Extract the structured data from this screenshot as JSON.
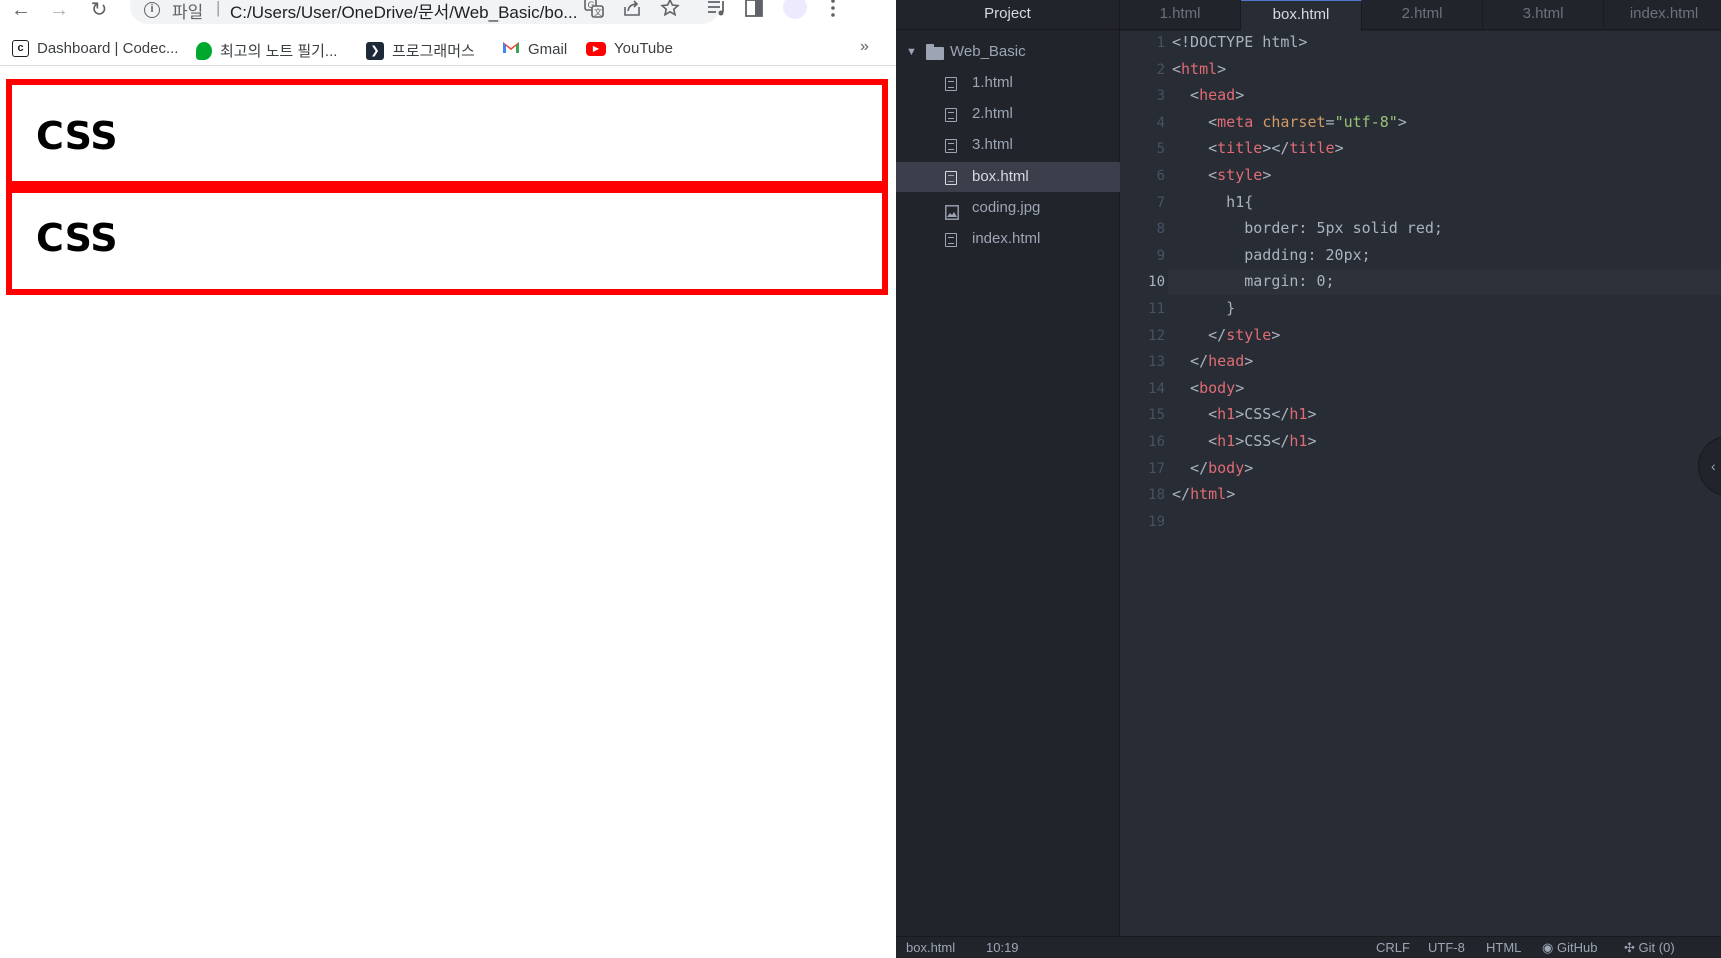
{
  "browser": {
    "nav": {
      "back": "←",
      "forward": "→",
      "reload": "↻"
    },
    "omnibox": {
      "protocol": "파일",
      "separator": "|",
      "url": "C:/Users/User/OneDrive/문서/Web_Basic/bo..."
    },
    "bookmarks": [
      {
        "label": "Dashboard | Codec...",
        "icon": "codecademy-icon"
      },
      {
        "label": "최고의 노트 필기...",
        "icon": "evernote-icon"
      },
      {
        "label": "프로그래머스",
        "icon": "programmers-icon"
      },
      {
        "label": "Gmail",
        "icon": "gmail-icon"
      },
      {
        "label": "YouTube",
        "icon": "youtube-icon"
      }
    ],
    "bookmarks_more": "»",
    "page": {
      "headings": [
        "CSS",
        "CSS"
      ],
      "border_color": "#ff0000"
    }
  },
  "editor": {
    "tree_header": "Project",
    "folder": "Web_Basic",
    "files": [
      "1.html",
      "2.html",
      "3.html",
      "box.html",
      "coding.jpg",
      "index.html"
    ],
    "selected_file": "box.html",
    "tabs": [
      "1.html",
      "box.html",
      "2.html",
      "3.html",
      "index.html"
    ],
    "active_tab": "box.html",
    "line_numbers": [
      "1",
      "2",
      "3",
      "4",
      "5",
      "6",
      "7",
      "8",
      "9",
      "10",
      "11",
      "12",
      "13",
      "14",
      "15",
      "16",
      "17",
      "18",
      "19"
    ],
    "current_line": "10",
    "code_lines": [
      "<!DOCTYPE html>",
      "<html>",
      "  <head>",
      "    <meta charset=\"utf-8\">",
      "    <title></title>",
      "    <style>",
      "      h1{",
      "        border: 5px solid red;",
      "        padding: 20px;",
      "        margin: 0;",
      "      }",
      "    </style>",
      "  </head>",
      "  <body>",
      "    <h1>CSS</h1>",
      "    <h1>CSS</h1>",
      "  </body>",
      "</html>",
      ""
    ],
    "status": {
      "file": "box.html",
      "cursor": "10:19",
      "line_ending": "CRLF",
      "encoding": "UTF-8",
      "grammar": "HTML",
      "github": "GitHub",
      "git": "Git (0)"
    },
    "colors": {
      "bg": "#282c34",
      "tag": "#e06c75",
      "attr": "#d19a66",
      "string": "#98c379"
    }
  }
}
